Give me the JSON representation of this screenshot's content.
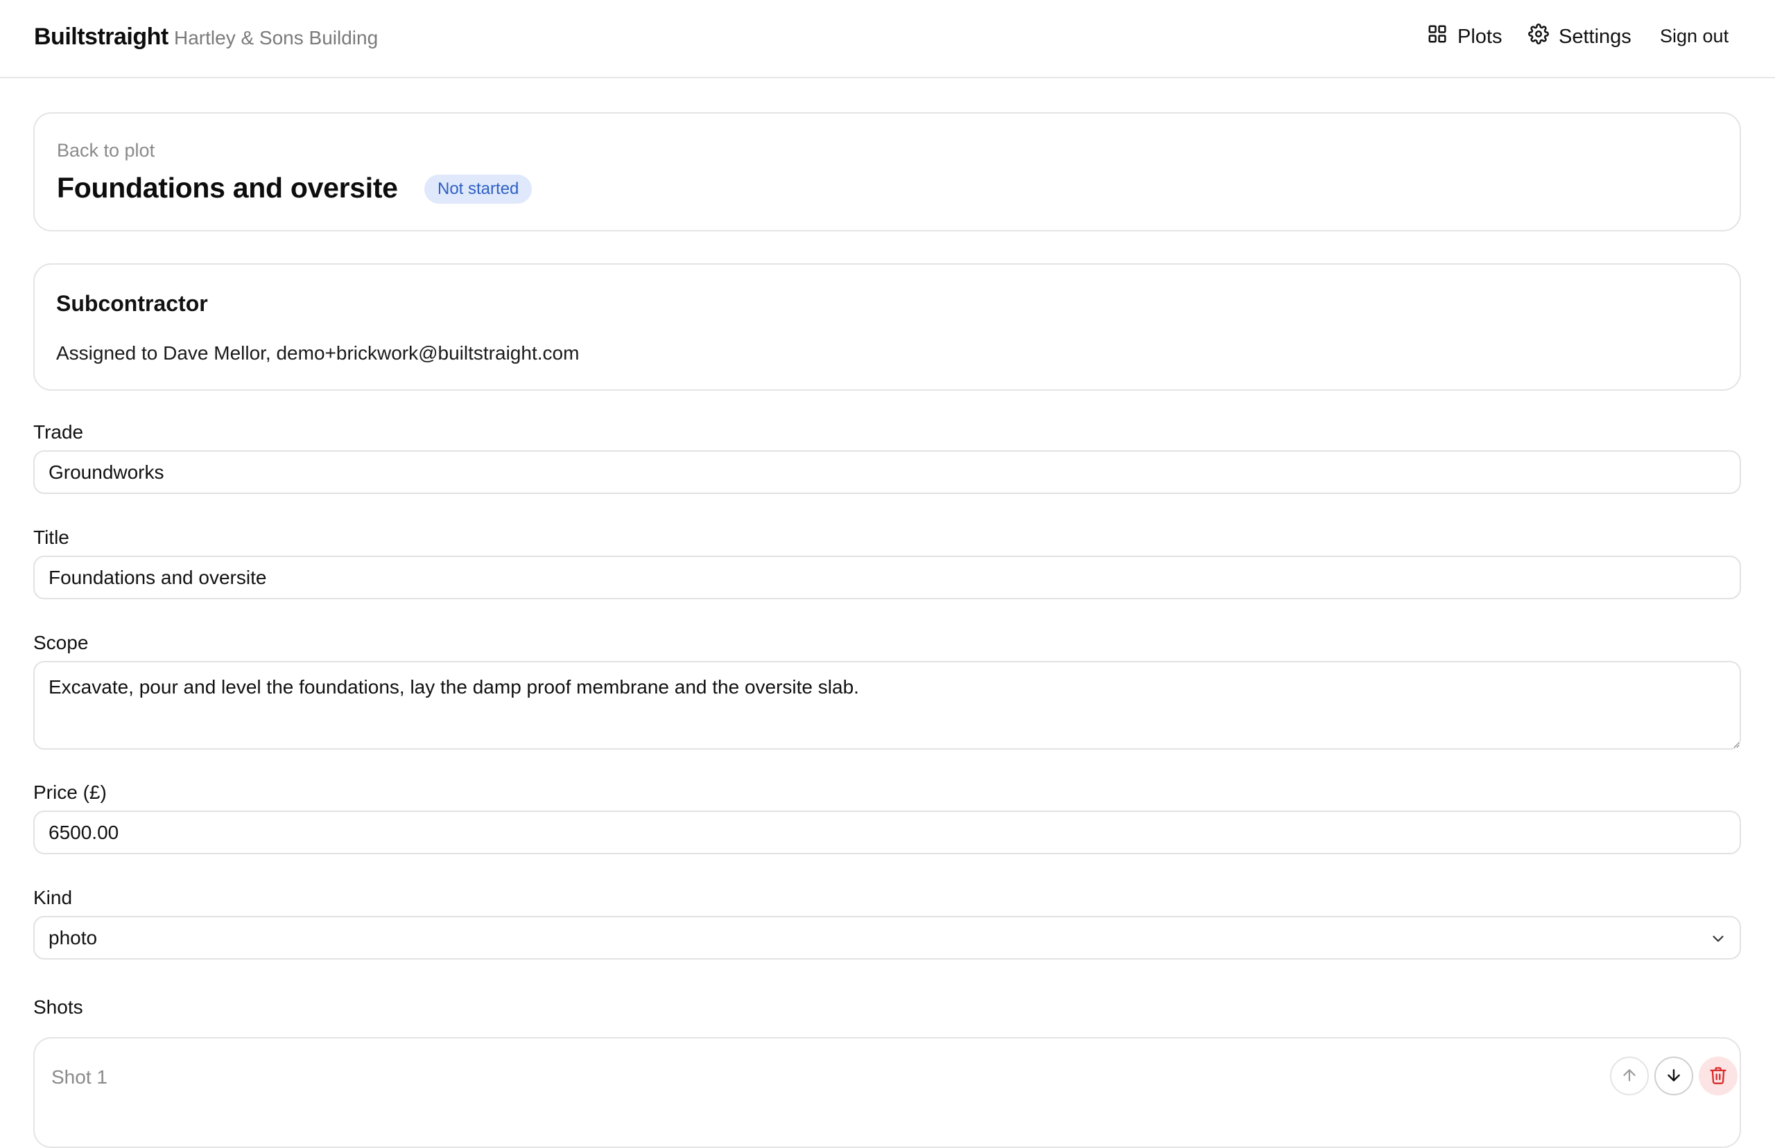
{
  "header": {
    "brand": "Builtstraight",
    "org": "Hartley & Sons Building",
    "nav": {
      "plots": "Plots",
      "settings": "Settings",
      "sign_out": "Sign out"
    }
  },
  "task": {
    "back_link": "Back to plot",
    "title": "Foundations and oversite",
    "status": "Not started"
  },
  "subcontractor": {
    "heading": "Subcontractor",
    "assignment": "Assigned to Dave Mellor, demo+brickwork@builtstraight.com"
  },
  "form": {
    "trade": {
      "label": "Trade",
      "value": "Groundworks"
    },
    "title": {
      "label": "Title",
      "value": "Foundations and oversite"
    },
    "scope": {
      "label": "Scope",
      "value": "Excavate, pour and level the foundations, lay the damp proof membrane and the oversite slab."
    },
    "price": {
      "label": "Price (£)",
      "value": "6500.00"
    },
    "kind": {
      "label": "Kind",
      "value": "photo"
    }
  },
  "shots": {
    "label": "Shots",
    "items": [
      {
        "label": "Shot 1"
      }
    ]
  },
  "colors": {
    "badge_bg": "#dfe9fb",
    "badge_text": "#2f5fc4",
    "delete_bg": "#fde4e4",
    "delete_icon": "#d92b2b"
  }
}
